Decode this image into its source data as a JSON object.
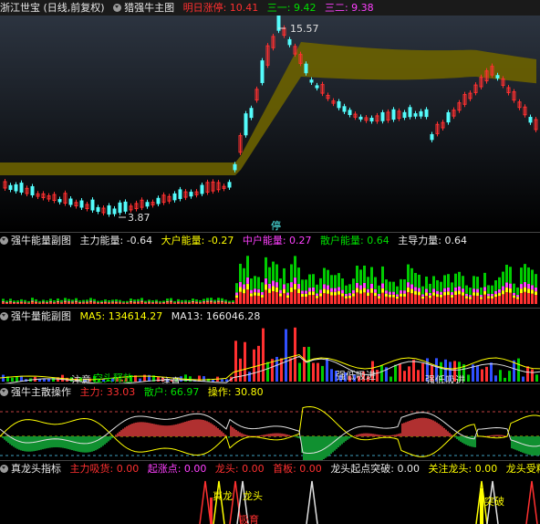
{
  "main": {
    "stock": "浙江世宝 (日线,前复权)",
    "indicator": "猎强牛主图",
    "limit_label": "明日涨停: 10.41",
    "line1_label": "三一: 9.42",
    "line2_label": "三二: 9.38",
    "high_price": "15.57",
    "low_price": "3.87",
    "stop_tag": "停"
  },
  "vol": {
    "title": "强牛能量副图",
    "main_energy": "主力能量: -0.64",
    "big_energy": "大户能量: -0.27",
    "mid_energy": "中户能量: 0.27",
    "retail_energy": "散户能量: 0.64",
    "main_guide": "主导力量: 0.64"
  },
  "energy": {
    "title": "强牛量能副图",
    "ma5": "MA5: 134614.27",
    "ma13": "MA13: 166046.28",
    "note1": "注意",
    "note2": "空头释放",
    "note3": "注意",
    "note4": "强低吸进",
    "note5": "强低吸进"
  },
  "ops": {
    "title": "强牛主散操作",
    "main_force": "主力: 33.03",
    "retail": "散户: 66.97",
    "operation": "操作: 30.80"
  },
  "dragon": {
    "title": "真龙头指标",
    "suck": "主力吸货: 0.00",
    "rise": "起涨点: 0.00",
    "dragon_head": "龙头: 0.00",
    "first_board": "首板: 0.00",
    "start_break": "龙头起点突破: 0.00",
    "watch": "关注龙头: 0.00",
    "dragon_trunc": "龙头受精",
    "mark1": "真龙",
    "mark2": "龙头",
    "mark3": "突破",
    "mark4": "吸育"
  },
  "colors": {
    "up": "#ff3030",
    "down": "#54fcfc",
    "band": "#6b6200",
    "yellow": "#ffff00",
    "magenta": "#ff40ff",
    "green": "#00cc00"
  }
}
